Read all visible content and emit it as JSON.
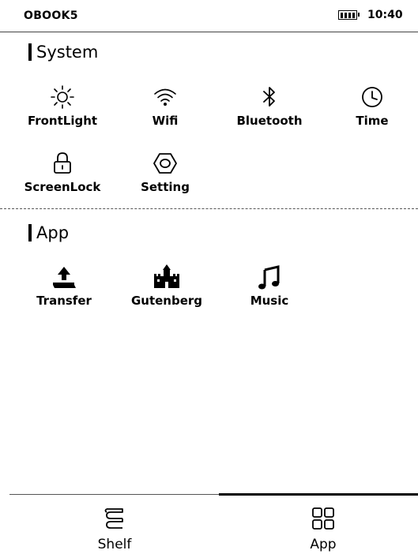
{
  "status_bar": {
    "device_name": "OBOOK5",
    "time": "10:40",
    "battery_icon": "battery-icon"
  },
  "system_section": {
    "title": "System",
    "items": [
      {
        "label": "FrontLight",
        "icon": "sun-icon"
      },
      {
        "label": "Wifi",
        "icon": "wifi-icon"
      },
      {
        "label": "Bluetooth",
        "icon": "bluetooth-icon"
      },
      {
        "label": "Time",
        "icon": "clock-icon"
      },
      {
        "label": "ScreenLock",
        "icon": "lock-icon"
      },
      {
        "label": "Setting",
        "icon": "hexagon-gear-icon"
      }
    ]
  },
  "app_section": {
    "title": "App",
    "items": [
      {
        "label": "Transfer",
        "icon": "upload-tray-icon"
      },
      {
        "label": "Gutenberg",
        "icon": "castle-icon"
      },
      {
        "label": "Music",
        "icon": "music-note-icon"
      }
    ]
  },
  "bottom_nav": {
    "tabs": [
      {
        "label": "Shelf",
        "icon": "books-icon",
        "active": false
      },
      {
        "label": "App",
        "icon": "grid-icon",
        "active": true
      }
    ]
  }
}
